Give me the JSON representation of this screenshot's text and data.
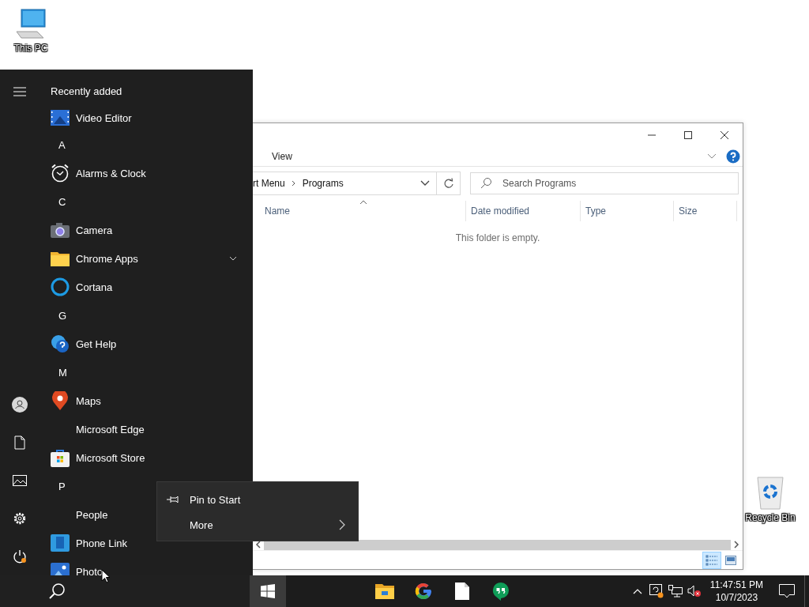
{
  "desktop_icons": [
    {
      "label": "This PC"
    },
    {
      "label": "Recycle Bin"
    }
  ],
  "start_menu": {
    "items": [
      {
        "kind": "heading",
        "label": "Recently added"
      },
      {
        "kind": "app",
        "label": "Video Editor"
      },
      {
        "kind": "letter",
        "label": "A"
      },
      {
        "kind": "app",
        "label": "Alarms & Clock"
      },
      {
        "kind": "letter",
        "label": "C"
      },
      {
        "kind": "app",
        "label": "Camera"
      },
      {
        "kind": "folder",
        "label": "Chrome Apps",
        "expanded": false
      },
      {
        "kind": "app",
        "label": "Cortana"
      },
      {
        "kind": "letter",
        "label": "G"
      },
      {
        "kind": "app",
        "label": "Get Help"
      },
      {
        "kind": "letter",
        "label": "M"
      },
      {
        "kind": "app",
        "label": "Maps"
      },
      {
        "kind": "app_plain",
        "label": "Microsoft Edge"
      },
      {
        "kind": "app",
        "label": "Microsoft Store"
      },
      {
        "kind": "letter",
        "label": "P"
      },
      {
        "kind": "app_plain",
        "label": "People"
      },
      {
        "kind": "app",
        "label": "Phone Link"
      },
      {
        "kind": "app",
        "label": "Photo"
      }
    ]
  },
  "explorer": {
    "tab": "View",
    "path": [
      "rt Menu",
      "Programs"
    ],
    "search": {
      "placeholder": "Search Programs"
    },
    "columns": [
      {
        "label": "Name",
        "sorted": true
      },
      {
        "label": "Date modified",
        "sorted": false
      },
      {
        "label": "Type",
        "sorted": false
      },
      {
        "label": "Size",
        "sorted": false
      }
    ],
    "empty_message": "This folder is empty.",
    "view_modes": [
      {
        "selected": true
      },
      {
        "selected": false
      }
    ]
  },
  "context_menu": {
    "items": [
      {
        "kind": "command",
        "label": "Pin to Start"
      },
      {
        "kind": "submenu",
        "label": "More"
      }
    ]
  },
  "taskbar": {
    "start_open": true,
    "clock": {
      "time": "11:47:51 PM",
      "date": "10/7/2023"
    }
  }
}
